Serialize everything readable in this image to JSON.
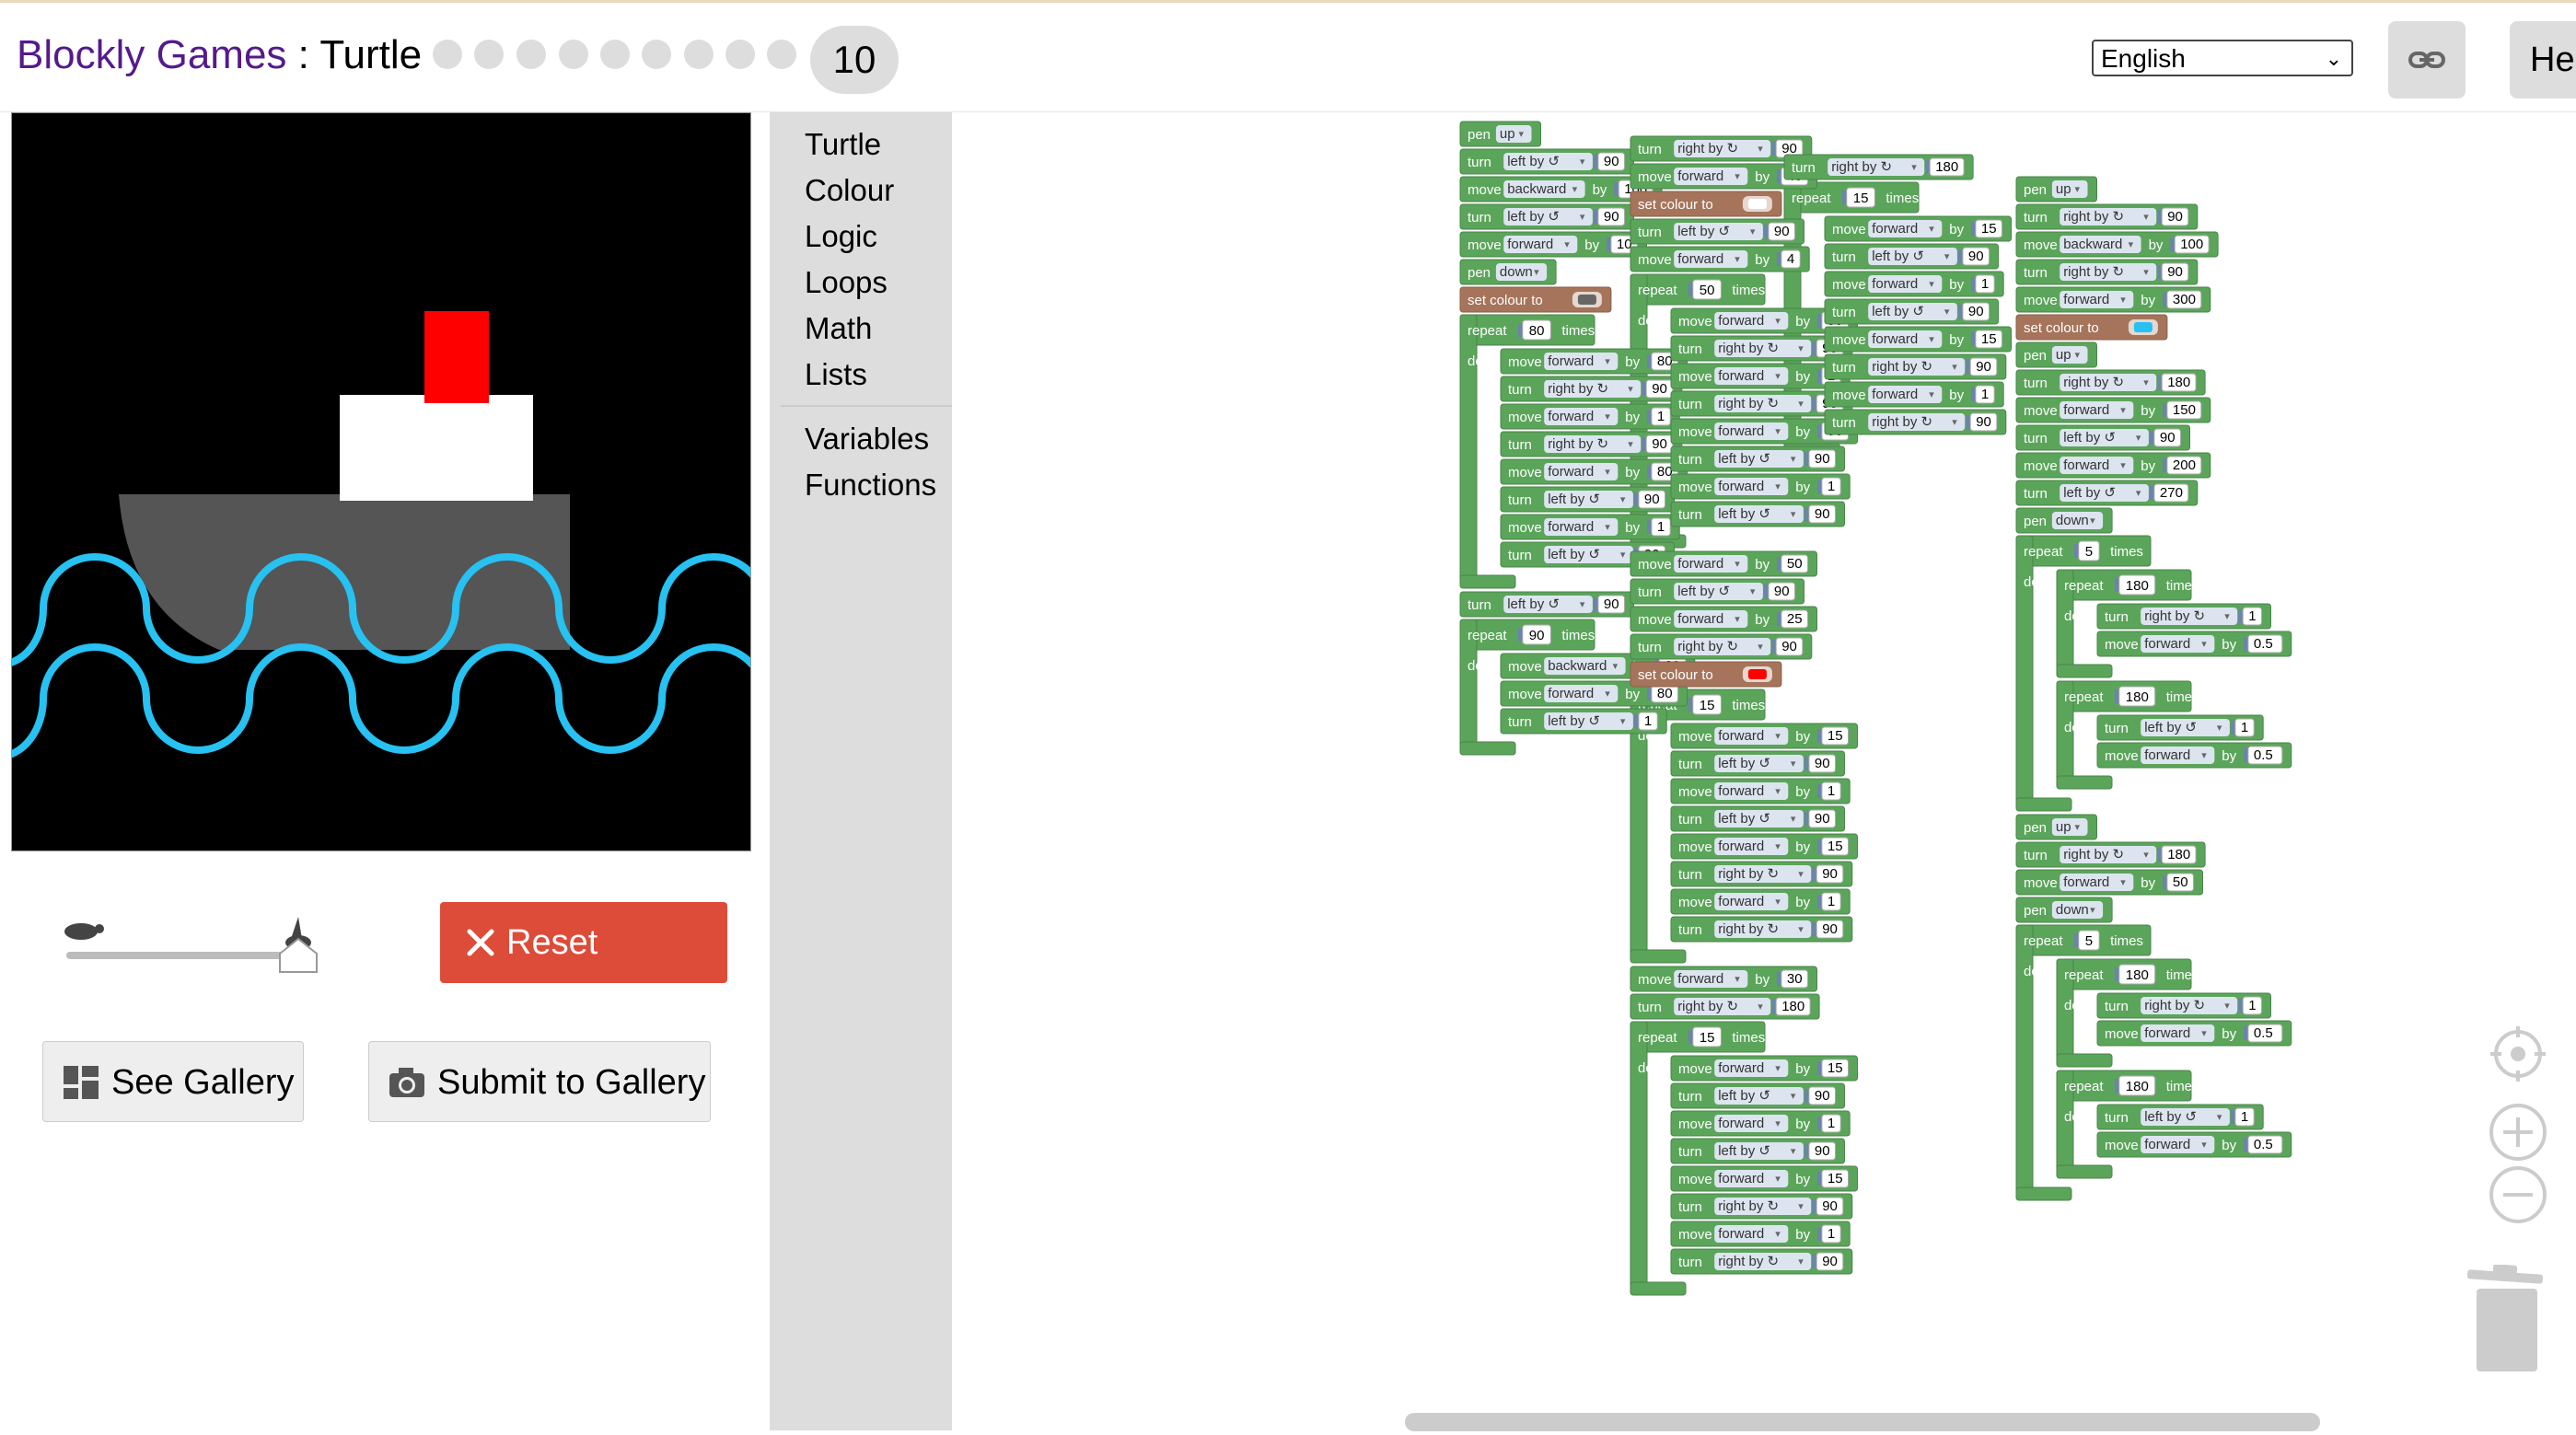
{
  "header": {
    "title_brand": "Blockly Games",
    "title_sep": " : ",
    "title_game": "Turtle",
    "current_level": "10",
    "language": "English",
    "help_label": "Help"
  },
  "toolbox": {
    "categories": [
      "Turtle",
      "Colour",
      "Logic",
      "Loops",
      "Math",
      "Lists",
      "Variables",
      "Functions"
    ]
  },
  "controls": {
    "reset_label": "Reset",
    "gallery_label": "See Gallery",
    "submit_label": "Submit to Gallery"
  },
  "colors": {
    "turtle_block": "#5ba55b",
    "colour_block": "#a5745b",
    "field_bg": "#dce4ef",
    "number_bg": "#ffffff",
    "reset_red": "#dd4b39",
    "title_purple": "#551a8b",
    "wave_blue": "#27c1f2",
    "ship_red": "#ff0000",
    "ship_grey": "#555555"
  },
  "stacks": [
    [
      {
        "t": "pen",
        "f": "up"
      },
      {
        "t": "turn",
        "f": "left by ↺",
        "n": "90"
      },
      {
        "t": "move",
        "f": "backward",
        "n": "100"
      },
      {
        "t": "turn",
        "f": "left by ↺",
        "n": "90"
      },
      {
        "t": "move",
        "f": "forward",
        "n": "10"
      },
      {
        "t": "pen",
        "f": "down"
      },
      {
        "t": "colour",
        "c": "#666666"
      },
      {
        "t": "repeat",
        "n": "80",
        "body": [
          {
            "t": "move",
            "f": "forward",
            "n": "80"
          },
          {
            "t": "turn",
            "f": "right by ↻",
            "n": "90"
          },
          {
            "t": "move",
            "f": "forward",
            "n": "1"
          },
          {
            "t": "turn",
            "f": "right by ↻",
            "n": "90"
          },
          {
            "t": "move",
            "f": "forward",
            "n": "80"
          },
          {
            "t": "turn",
            "f": "left by ↺",
            "n": "90"
          },
          {
            "t": "move",
            "f": "forward",
            "n": "1"
          },
          {
            "t": "turn",
            "f": "left by ↺",
            "n": "90"
          }
        ]
      },
      {
        "t": "turn",
        "f": "left by ↺",
        "n": "90"
      },
      {
        "t": "repeat",
        "n": "90",
        "body": [
          {
            "t": "move",
            "f": "backward",
            "n": "80"
          },
          {
            "t": "move",
            "f": "forward",
            "n": "80"
          },
          {
            "t": "turn",
            "f": "left by ↺",
            "n": "1"
          }
        ]
      }
    ],
    [
      {
        "t": "turn",
        "f": "right by ↻",
        "n": "90"
      },
      {
        "t": "move",
        "f": "forward",
        "n": "40"
      },
      {
        "t": "colour",
        "c": "#ffffff"
      },
      {
        "t": "turn",
        "f": "left by ↺",
        "n": "90"
      },
      {
        "t": "move",
        "f": "forward",
        "n": "4"
      },
      {
        "t": "repeat",
        "n": "50",
        "body": [
          {
            "t": "move",
            "f": "forward",
            "n": "50"
          },
          {
            "t": "turn",
            "f": "right by ↻",
            "n": "90"
          },
          {
            "t": "move",
            "f": "forward",
            "n": "1"
          },
          {
            "t": "turn",
            "f": "right by ↻",
            "n": "90"
          },
          {
            "t": "move",
            "f": "forward",
            "n": "50"
          },
          {
            "t": "turn",
            "f": "left by ↺",
            "n": "90"
          },
          {
            "t": "move",
            "f": "forward",
            "n": "1"
          },
          {
            "t": "turn",
            "f": "left by ↺",
            "n": "90"
          }
        ]
      },
      {
        "t": "move",
        "f": "forward",
        "n": "50"
      },
      {
        "t": "turn",
        "f": "left by ↺",
        "n": "90"
      },
      {
        "t": "move",
        "f": "forward",
        "n": "25"
      },
      {
        "t": "turn",
        "f": "right by ↻",
        "n": "90"
      },
      {
        "t": "colour",
        "c": "#ff0000"
      },
      {
        "t": "repeat",
        "n": "15",
        "body": [
          {
            "t": "move",
            "f": "forward",
            "n": "15"
          },
          {
            "t": "turn",
            "f": "left by ↺",
            "n": "90"
          },
          {
            "t": "move",
            "f": "forward",
            "n": "1"
          },
          {
            "t": "turn",
            "f": "left by ↺",
            "n": "90"
          },
          {
            "t": "move",
            "f": "forward",
            "n": "15"
          },
          {
            "t": "turn",
            "f": "right by ↻",
            "n": "90"
          },
          {
            "t": "move",
            "f": "forward",
            "n": "1"
          },
          {
            "t": "turn",
            "f": "right by ↻",
            "n": "90"
          }
        ]
      },
      {
        "t": "move",
        "f": "forward",
        "n": "30"
      },
      {
        "t": "turn",
        "f": "right by ↻",
        "n": "180"
      },
      {
        "t": "repeat",
        "n": "15",
        "body": [
          {
            "t": "move",
            "f": "forward",
            "n": "15"
          },
          {
            "t": "turn",
            "f": "left by ↺",
            "n": "90"
          },
          {
            "t": "move",
            "f": "forward",
            "n": "1"
          },
          {
            "t": "turn",
            "f": "left by ↺",
            "n": "90"
          },
          {
            "t": "move",
            "f": "forward",
            "n": "15"
          },
          {
            "t": "turn",
            "f": "right by ↻",
            "n": "90"
          },
          {
            "t": "move",
            "f": "forward",
            "n": "1"
          },
          {
            "t": "turn",
            "f": "right by ↻",
            "n": "90"
          }
        ]
      }
    ],
    [
      {
        "t": "turn",
        "f": "right by ↻",
        "n": "180"
      },
      {
        "t": "repeat",
        "n": "15",
        "body": [
          {
            "t": "move",
            "f": "forward",
            "n": "15"
          },
          {
            "t": "turn",
            "f": "left by ↺",
            "n": "90"
          },
          {
            "t": "move",
            "f": "forward",
            "n": "1"
          },
          {
            "t": "turn",
            "f": "left by ↺",
            "n": "90"
          },
          {
            "t": "move",
            "f": "forward",
            "n": "15"
          },
          {
            "t": "turn",
            "f": "right by ↻",
            "n": "90"
          },
          {
            "t": "move",
            "f": "forward",
            "n": "1"
          },
          {
            "t": "turn",
            "f": "right by ↻",
            "n": "90"
          }
        ]
      }
    ],
    [
      {
        "t": "pen",
        "f": "up"
      },
      {
        "t": "turn",
        "f": "right by ↻",
        "n": "90"
      },
      {
        "t": "move",
        "f": "backward",
        "n": "100"
      },
      {
        "t": "turn",
        "f": "right by ↻",
        "n": "90"
      },
      {
        "t": "move",
        "f": "forward",
        "n": "300"
      },
      {
        "t": "colour",
        "c": "#27c1f2"
      },
      {
        "t": "pen",
        "f": "up"
      },
      {
        "t": "turn",
        "f": "right by ↻",
        "n": "180"
      },
      {
        "t": "move",
        "f": "forward",
        "n": "150"
      },
      {
        "t": "turn",
        "f": "left by ↺",
        "n": "90"
      },
      {
        "t": "move",
        "f": "forward",
        "n": "200"
      },
      {
        "t": "turn",
        "f": "left by ↺",
        "n": "270"
      },
      {
        "t": "pen",
        "f": "down"
      },
      {
        "t": "repeat",
        "n": "5",
        "body": [
          {
            "t": "repeat",
            "n": "180",
            "body": [
              {
                "t": "turn",
                "f": "right by ↻",
                "n": "1"
              },
              {
                "t": "move",
                "f": "forward",
                "n": "0.5"
              }
            ]
          },
          {
            "t": "repeat",
            "n": "180",
            "body": [
              {
                "t": "turn",
                "f": "left by ↺",
                "n": "1"
              },
              {
                "t": "move",
                "f": "forward",
                "n": "0.5"
              }
            ]
          }
        ]
      },
      {
        "t": "pen",
        "f": "up"
      },
      {
        "t": "turn",
        "f": "right by ↻",
        "n": "180"
      },
      {
        "t": "move",
        "f": "forward",
        "n": "50"
      },
      {
        "t": "pen",
        "f": "down"
      },
      {
        "t": "repeat",
        "n": "5",
        "body": [
          {
            "t": "repeat",
            "n": "180",
            "body": [
              {
                "t": "turn",
                "f": "right by ↻",
                "n": "1"
              },
              {
                "t": "move",
                "f": "forward",
                "n": "0.5"
              }
            ]
          },
          {
            "t": "repeat",
            "n": "180",
            "body": [
              {
                "t": "turn",
                "f": "left by ↺",
                "n": "1"
              },
              {
                "t": "move",
                "f": "forward",
                "n": "0.5"
              }
            ]
          }
        ]
      }
    ]
  ]
}
